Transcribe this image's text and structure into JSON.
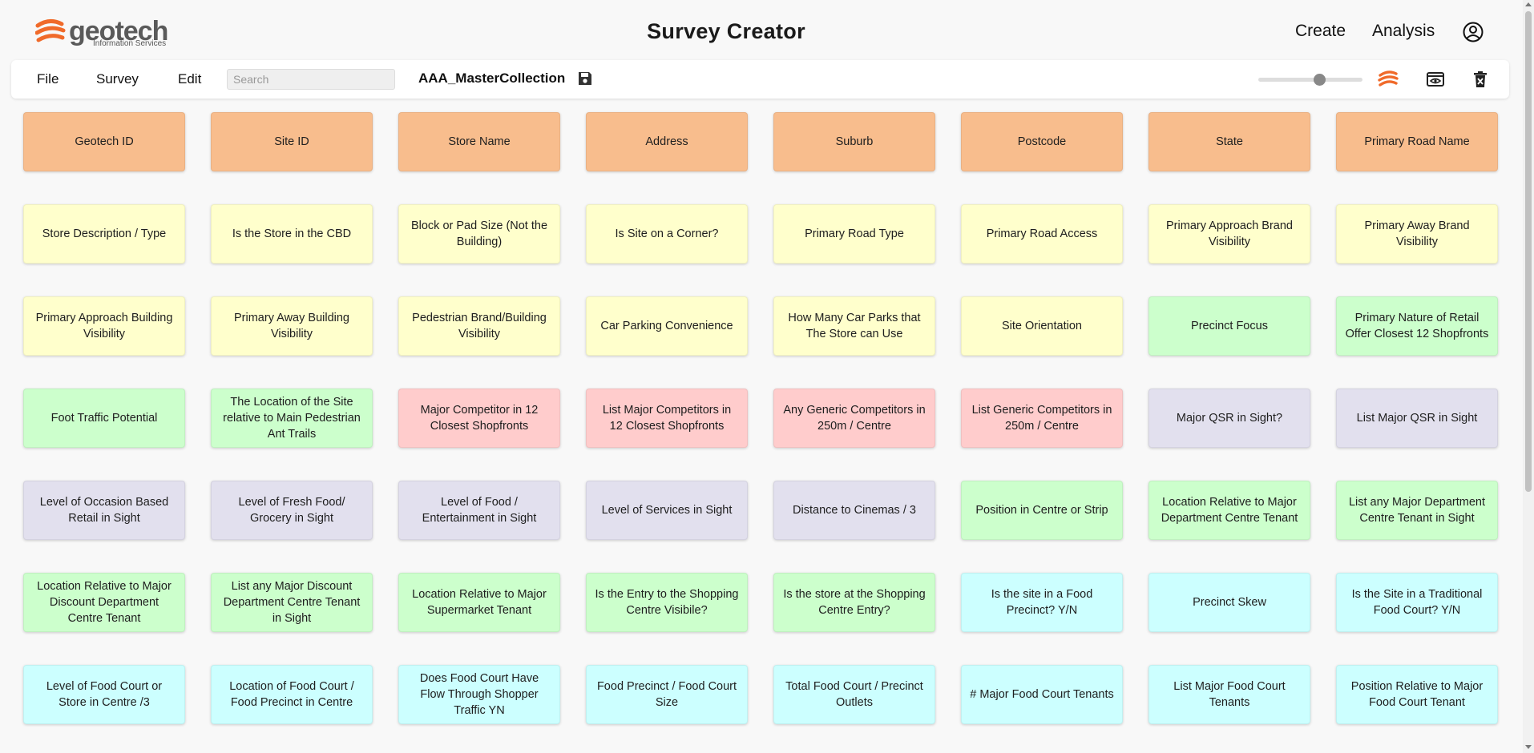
{
  "logo": {
    "word": "geotech",
    "sub": "Information Services"
  },
  "header": {
    "title": "Survey Creator",
    "create": "Create",
    "analysis": "Analysis",
    "account_icon": "user-circle-icon"
  },
  "toolbar": {
    "menu": {
      "file": "File",
      "survey": "Survey",
      "edit": "Edit"
    },
    "search_placeholder": "Search",
    "collection": "AAA_MasterCollection",
    "zoom_level": 0.6,
    "icons": [
      "save-icon",
      "geotech-logo-icon",
      "preview-icon",
      "delete-icon"
    ]
  },
  "colors": {
    "orange": "#f8bd8d",
    "yellow": "#ffffcc",
    "green": "#ccffcc",
    "red": "#ffcccc",
    "purple": "#e2e0ee",
    "cyan": "#ccffff",
    "accent": "#f06a2a"
  },
  "grid": {
    "rows": [
      [
        {
          "label": "Geotech ID",
          "color": "orange"
        },
        {
          "label": "Site ID",
          "color": "orange"
        },
        {
          "label": "Store Name",
          "color": "orange"
        },
        {
          "label": "Address",
          "color": "orange"
        },
        {
          "label": "Suburb",
          "color": "orange"
        },
        {
          "label": "Postcode",
          "color": "orange"
        },
        {
          "label": "State",
          "color": "orange"
        },
        {
          "label": "Primary Road Name",
          "color": "orange"
        }
      ],
      [
        {
          "label": "Store Description / Type",
          "color": "yellow"
        },
        {
          "label": "Is the Store in the CBD",
          "color": "yellow"
        },
        {
          "label": "Block or Pad Size (Not the Building)",
          "color": "yellow"
        },
        {
          "label": "Is Site on a Corner?",
          "color": "yellow"
        },
        {
          "label": "Primary Road Type",
          "color": "yellow"
        },
        {
          "label": "Primary Road Access",
          "color": "yellow"
        },
        {
          "label": "Primary Approach Brand Visibility",
          "color": "yellow"
        },
        {
          "label": "Primary Away Brand Visibility",
          "color": "yellow"
        }
      ],
      [
        {
          "label": "Primary Approach Building Visibility",
          "color": "yellow"
        },
        {
          "label": "Primary Away Building Visibility",
          "color": "yellow"
        },
        {
          "label": "Pedestrian Brand/Building Visibility",
          "color": "yellow"
        },
        {
          "label": "Car Parking Convenience",
          "color": "yellow"
        },
        {
          "label": "How Many Car Parks that The Store can Use",
          "color": "yellow"
        },
        {
          "label": "Site Orientation",
          "color": "yellow"
        },
        {
          "label": "Precinct Focus",
          "color": "green"
        },
        {
          "label": "Primary Nature of Retail Offer Closest 12 Shopfronts",
          "color": "green"
        }
      ],
      [
        {
          "label": "Foot Traffic Potential",
          "color": "green"
        },
        {
          "label": "The Location of the Site relative to Main Pedestrian Ant Trails",
          "color": "green"
        },
        {
          "label": "Major Competitor in 12 Closest Shopfronts",
          "color": "red"
        },
        {
          "label": "List Major Competitors in 12 Closest Shopfronts",
          "color": "red"
        },
        {
          "label": "Any Generic Competitors in 250m / Centre",
          "color": "red"
        },
        {
          "label": "List Generic Competitors in 250m / Centre",
          "color": "red"
        },
        {
          "label": "Major QSR in Sight?",
          "color": "purple"
        },
        {
          "label": "List Major QSR in Sight",
          "color": "purple"
        }
      ],
      [
        {
          "label": "Level of Occasion Based Retail in Sight",
          "color": "purple"
        },
        {
          "label": "Level of Fresh Food/ Grocery in Sight",
          "color": "purple"
        },
        {
          "label": "Level of Food / Entertainment in Sight",
          "color": "purple"
        },
        {
          "label": "Level of Services in Sight",
          "color": "purple"
        },
        {
          "label": "Distance to Cinemas / 3",
          "color": "purple"
        },
        {
          "label": "Position in Centre or Strip",
          "color": "green"
        },
        {
          "label": "Location Relative to Major Department Centre Tenant",
          "color": "green"
        },
        {
          "label": "List any Major Department Centre Tenant in Sight",
          "color": "green"
        }
      ],
      [
        {
          "label": "Location Relative to Major Discount Department Centre Tenant",
          "color": "green"
        },
        {
          "label": "List any Major Discount Department Centre Tenant in Sight",
          "color": "green"
        },
        {
          "label": "Location Relative to Major Supermarket Tenant",
          "color": "green"
        },
        {
          "label": "Is the Entry to the Shopping Centre Visibile?",
          "color": "green"
        },
        {
          "label": "Is the store at the Shopping Centre Entry?",
          "color": "green"
        },
        {
          "label": "Is the site in a Food Precinct? Y/N",
          "color": "cyan"
        },
        {
          "label": "Precinct Skew",
          "color": "cyan"
        },
        {
          "label": "Is the Site in a Traditional Food Court? Y/N",
          "color": "cyan"
        }
      ],
      [
        {
          "label": "Level of Food Court or Store in Centre /3",
          "color": "cyan"
        },
        {
          "label": "Location of Food Court / Food Precinct in Centre",
          "color": "cyan"
        },
        {
          "label": "Does Food Court Have Flow Through Shopper Traffic YN",
          "color": "cyan"
        },
        {
          "label": "Food Precinct / Food Court Size",
          "color": "cyan"
        },
        {
          "label": "Total Food Court / Precinct Outlets",
          "color": "cyan"
        },
        {
          "label": "# Major Food Court Tenants",
          "color": "cyan"
        },
        {
          "label": "List Major Food Court Tenants",
          "color": "cyan"
        },
        {
          "label": "Position Relative to Major Food Court Tenant",
          "color": "cyan"
        }
      ]
    ]
  }
}
